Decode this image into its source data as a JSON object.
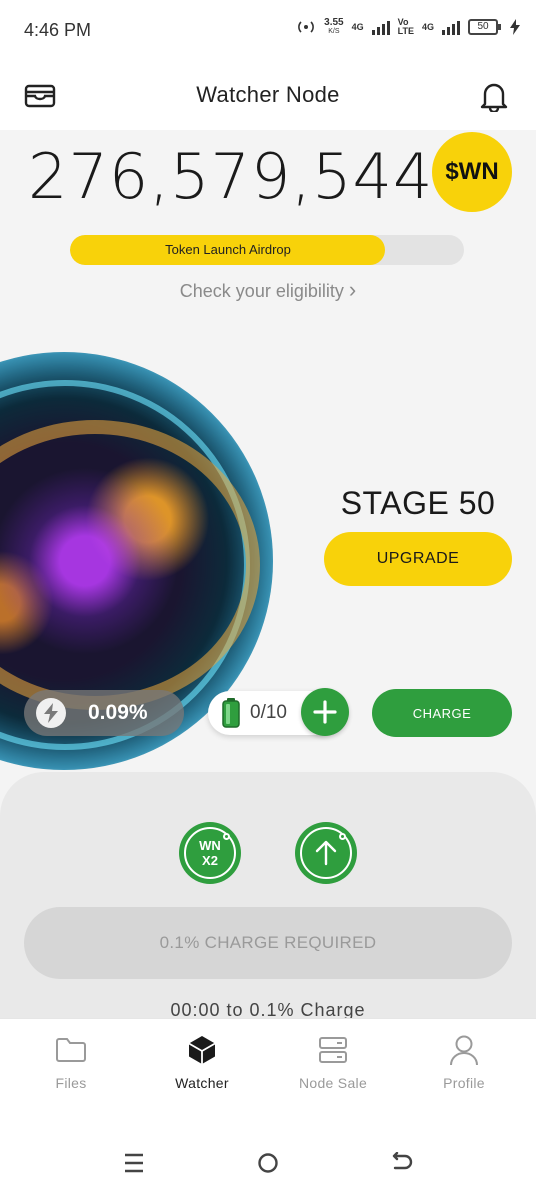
{
  "status_bar": {
    "time": "4:46 PM",
    "net_speed": "3.55",
    "net_unit": "K/S",
    "net1": "4G",
    "net2": "Vo",
    "net3": "LTE",
    "net4": "4G",
    "battery_level": "50"
  },
  "header": {
    "title": "Watcher Node",
    "left_icon": "wallet-icon",
    "right_icon": "bell-icon"
  },
  "balance": {
    "amount": "276,579,544",
    "coin_label": "$WN"
  },
  "airdrop": {
    "label": "Token Launch Airdrop",
    "progress_fraction": 0.8,
    "eligibility_link": "Check your eligibility",
    "chevron": "›"
  },
  "node": {
    "stage_label": "STAGE 50",
    "upgrade_label": "UPGRADE",
    "rate": "0.09%",
    "battery_count": "0/10",
    "charge_label": "CHARGE"
  },
  "sheet": {
    "multiplier_top": "WN",
    "multiplier_bottom": "X2",
    "required_label": "0.1% CHARGE REQUIRED",
    "timer_text": "00:00 to 0.1% Charge"
  },
  "nav": {
    "items": [
      {
        "label": "Files",
        "icon": "folder-icon"
      },
      {
        "label": "Watcher",
        "icon": "cube-icon"
      },
      {
        "label": "Node Sale",
        "icon": "server-icon"
      },
      {
        "label": "Profile",
        "icon": "user-icon"
      }
    ],
    "active": "Watcher"
  },
  "colors": {
    "accent_yellow": "#f8d20a",
    "accent_green": "#2f9e3e",
    "background": "#f4f4f4"
  }
}
